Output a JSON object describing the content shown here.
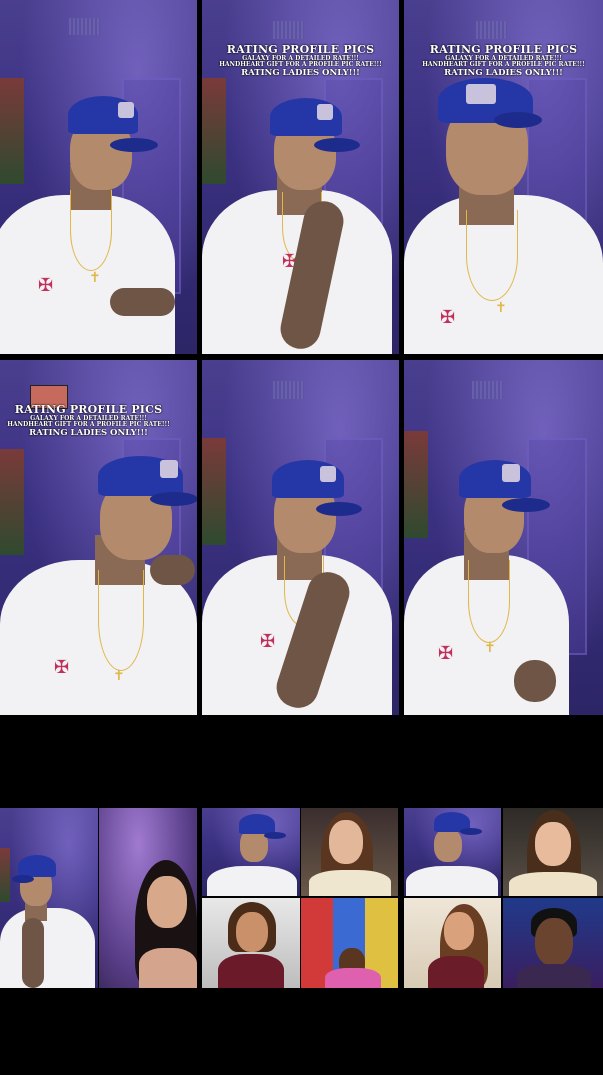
{
  "overlay": {
    "title": "RATING PROFILE PICS",
    "line1": "GALAXY FOR A DETAILED RATE!!!",
    "line2": "HANDHEART GIFT FOR A PROFILE PIC RATE!!!",
    "line3": "RATING LADIES ONLY!!!"
  },
  "colors": {
    "wall_purple": "#3b3182",
    "cap_blue": "#2537a6",
    "shirt_white": "#f2f1f3",
    "chain_gold": "#e0b84a",
    "background": "#000000"
  },
  "icons": {
    "cross_pendant": "✝",
    "shirt_print": "✠"
  }
}
